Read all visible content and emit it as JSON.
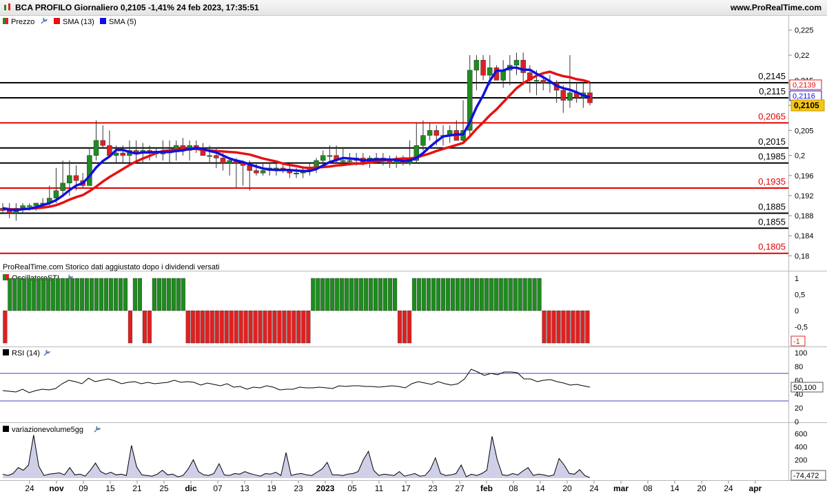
{
  "header": {
    "title": "BCA PROFILO Giornaliero 0,2105 -1,41% 24 feb 2023, 17:35:51",
    "site": "www.ProRealTime.com"
  },
  "legend_main": {
    "prezzo": "Prezzo",
    "sma13": "SMA (13)",
    "sma5": "SMA (5)"
  },
  "notice": "ProRealTime.com  Storico dati aggiustato dopo i dividendi versati",
  "panels": {
    "osc": {
      "name": "OscillatoreSTI",
      "ticks": [
        "1",
        "0,5",
        "0",
        "-0,5",
        "-1"
      ],
      "current": "-1"
    },
    "rsi": {
      "name": "RSI (14)",
      "ticks": [
        "100",
        "80",
        "60",
        "40",
        "20",
        "0"
      ],
      "current": "50,100"
    },
    "vol": {
      "name": "variazionevolume5gg",
      "ticks": [
        "600",
        "400",
        "200",
        "0"
      ],
      "current": "-74,472"
    }
  },
  "price_axis": {
    "ticks": [
      "0,225",
      "0,22",
      "0,215",
      "0,21",
      "0,205",
      "0,2",
      "0,196",
      "0,192",
      "0,188",
      "0,184",
      "0,18"
    ]
  },
  "levels": [
    {
      "label": "0,2145",
      "color": "#000000"
    },
    {
      "label": "0,2115",
      "color": "#000000"
    },
    {
      "label": "0,2065",
      "color": "#e00000"
    },
    {
      "label": "0,2015",
      "color": "#000000"
    },
    {
      "label": "0,1985",
      "color": "#000000"
    },
    {
      "label": "0,1935",
      "color": "#e00000"
    },
    {
      "label": "0,1885",
      "color": "#000000"
    },
    {
      "label": "0,1855",
      "color": "#000000"
    },
    {
      "label": "0,1805",
      "color": "#e00000"
    }
  ],
  "price_tags": {
    "sma13": "0,2139",
    "sma5": "0,2116",
    "last": "0,2105"
  },
  "x_axis": {
    "labels": [
      "24",
      "nov",
      "09",
      "15",
      "21",
      "25",
      "dic",
      "07",
      "13",
      "19",
      "23",
      "2023",
      "05",
      "11",
      "17",
      "23",
      "27",
      "feb",
      "08",
      "14",
      "20",
      "24",
      "mar",
      "08",
      "14",
      "20",
      "24",
      "apr"
    ]
  },
  "colors": {
    "up": "#1e8c1e",
    "down": "#e02020",
    "sma13": "#e81010",
    "sma5": "#1010e0",
    "rsi_band": "#4040c0"
  },
  "chart_data": [
    {
      "type": "candlestick",
      "title": "BCA PROFILO Giornaliero",
      "series_names": [
        "Prezzo",
        "SMA (13)",
        "SMA (5)"
      ],
      "ylim": [
        0.178,
        0.226
      ],
      "x": [
        "24 ott",
        "25 ott",
        "26 ott",
        "27 ott",
        "28 ott",
        "31 ott",
        "1 nov",
        "2 nov",
        "3 nov",
        "4 nov",
        "7 nov",
        "8 nov",
        "9 nov",
        "10 nov",
        "11 nov",
        "14 nov",
        "15 nov",
        "16 nov",
        "17 nov",
        "18 nov",
        "21 nov",
        "22 nov",
        "23 nov",
        "24 nov",
        "25 nov",
        "28 nov",
        "29 nov",
        "30 nov",
        "1 dic",
        "2 dic",
        "5 dic",
        "6 dic",
        "7 dic",
        "8 dic",
        "9 dic",
        "12 dic",
        "13 dic",
        "14 dic",
        "15 dic",
        "16 dic",
        "19 dic",
        "20 dic",
        "21 dic",
        "22 dic",
        "23 dic",
        "27 dic",
        "28 dic",
        "29 dic",
        "30 dic",
        "2 gen",
        "3 gen",
        "4 gen",
        "5 gen",
        "6 gen",
        "9 gen",
        "10 gen",
        "11 gen",
        "12 gen",
        "13 gen",
        "16 gen",
        "17 gen",
        "18 gen",
        "19 gen",
        "20 gen",
        "23 gen",
        "24 gen",
        "25 gen",
        "26 gen",
        "27 gen",
        "30 gen",
        "31 gen",
        "1 feb",
        "2 feb",
        "3 feb",
        "6 feb",
        "7 feb",
        "8 feb",
        "9 feb",
        "10 feb",
        "13 feb",
        "14 feb",
        "15 feb",
        "16 feb",
        "17 feb",
        "20 feb",
        "21 feb",
        "22 feb",
        "23 feb",
        "24 feb"
      ],
      "open": [
        0.1895,
        0.189,
        0.1885,
        0.1895,
        0.19,
        0.19,
        0.1905,
        0.1905,
        0.1915,
        0.193,
        0.1945,
        0.196,
        0.195,
        0.194,
        0.2,
        0.203,
        0.202,
        0.2,
        0.2005,
        0.2,
        0.201,
        0.2005,
        0.201,
        0.2005,
        0.2005,
        0.2005,
        0.201,
        0.202,
        0.201,
        0.202,
        0.2015,
        0.2,
        0.2,
        0.1995,
        0.1985,
        0.199,
        0.1985,
        0.198,
        0.197,
        0.1965,
        0.197,
        0.1975,
        0.1975,
        0.197,
        0.1965,
        0.1965,
        0.197,
        0.1975,
        0.199,
        0.2,
        0.2,
        0.199,
        0.199,
        0.199,
        0.1995,
        0.1985,
        0.1995,
        0.1995,
        0.199,
        0.1985,
        0.199,
        0.1985,
        0.199,
        0.202,
        0.204,
        0.205,
        0.204,
        0.204,
        0.205,
        0.203,
        0.205,
        0.217,
        0.219,
        0.216,
        0.2175,
        0.215,
        0.217,
        0.218,
        0.219,
        0.2165,
        0.215,
        0.215,
        0.2145,
        0.2145,
        0.213,
        0.211,
        0.2125,
        0.2115,
        0.2125
      ],
      "high": [
        0.1905,
        0.1905,
        0.1905,
        0.1905,
        0.1905,
        0.1905,
        0.1915,
        0.194,
        0.1975,
        0.199,
        0.199,
        0.198,
        0.1965,
        0.2015,
        0.207,
        0.206,
        0.205,
        0.202,
        0.202,
        0.203,
        0.203,
        0.2025,
        0.202,
        0.2015,
        0.203,
        0.203,
        0.203,
        0.2035,
        0.203,
        0.203,
        0.2025,
        0.202,
        0.2015,
        0.2005,
        0.1995,
        0.1995,
        0.199,
        0.199,
        0.1985,
        0.1985,
        0.1985,
        0.199,
        0.1985,
        0.198,
        0.1975,
        0.1975,
        0.1985,
        0.1995,
        0.201,
        0.202,
        0.202,
        0.2015,
        0.2005,
        0.2005,
        0.2005,
        0.2,
        0.2005,
        0.2005,
        0.2,
        0.2,
        0.2,
        0.203,
        0.2065,
        0.207,
        0.2065,
        0.206,
        0.206,
        0.206,
        0.207,
        0.211,
        0.22,
        0.22,
        0.22,
        0.22,
        0.218,
        0.219,
        0.22,
        0.2205,
        0.2205,
        0.218,
        0.217,
        0.216,
        0.216,
        0.215,
        0.214,
        0.22,
        0.2145,
        0.2145,
        0.2145
      ],
      "low": [
        0.1885,
        0.1875,
        0.187,
        0.1885,
        0.189,
        0.189,
        0.1895,
        0.19,
        0.1905,
        0.192,
        0.192,
        0.193,
        0.1935,
        0.194,
        0.199,
        0.2015,
        0.2,
        0.1985,
        0.1985,
        0.1985,
        0.199,
        0.1985,
        0.199,
        0.1995,
        0.199,
        0.1985,
        0.199,
        0.2,
        0.199,
        0.2005,
        0.2,
        0.1985,
        0.1975,
        0.197,
        0.196,
        0.1935,
        0.194,
        0.193,
        0.196,
        0.196,
        0.196,
        0.196,
        0.1965,
        0.1955,
        0.1955,
        0.1955,
        0.196,
        0.1965,
        0.1975,
        0.1985,
        0.1985,
        0.198,
        0.198,
        0.198,
        0.198,
        0.1975,
        0.1985,
        0.198,
        0.1975,
        0.1975,
        0.198,
        0.198,
        0.1985,
        0.201,
        0.203,
        0.202,
        0.202,
        0.2025,
        0.203,
        0.2025,
        0.204,
        0.213,
        0.215,
        0.214,
        0.215,
        0.2135,
        0.214,
        0.216,
        0.214,
        0.2125,
        0.212,
        0.213,
        0.2125,
        0.2105,
        0.2085,
        0.2095,
        0.2105,
        0.2095,
        0.21
      ],
      "close": [
        0.189,
        0.1885,
        0.1895,
        0.19,
        0.19,
        0.1905,
        0.1905,
        0.1915,
        0.193,
        0.1945,
        0.196,
        0.195,
        0.194,
        0.2,
        0.203,
        0.202,
        0.2,
        0.2005,
        0.2,
        0.201,
        0.2005,
        0.201,
        0.2005,
        0.2005,
        0.2005,
        0.201,
        0.202,
        0.201,
        0.202,
        0.2015,
        0.2,
        0.2,
        0.1995,
        0.1985,
        0.199,
        0.1985,
        0.198,
        0.197,
        0.1965,
        0.197,
        0.1975,
        0.1975,
        0.197,
        0.1965,
        0.1965,
        0.197,
        0.1975,
        0.199,
        0.2,
        0.2,
        0.199,
        0.199,
        0.199,
        0.1995,
        0.1985,
        0.1995,
        0.1995,
        0.199,
        0.1985,
        0.199,
        0.1985,
        0.199,
        0.202,
        0.204,
        0.205,
        0.204,
        0.204,
        0.205,
        0.203,
        0.205,
        0.217,
        0.219,
        0.216,
        0.2175,
        0.215,
        0.217,
        0.218,
        0.219,
        0.2165,
        0.215,
        0.215,
        0.2145,
        0.2145,
        0.213,
        0.211,
        0.2125,
        0.2115,
        0.2125,
        0.2105
      ],
      "sma13": [
        0.1895,
        0.1893,
        0.1892,
        0.1893,
        0.1894,
        0.1895,
        0.1896,
        0.1898,
        0.1901,
        0.1906,
        0.1912,
        0.1917,
        0.1921,
        0.1929,
        0.1938,
        0.1948,
        0.1957,
        0.1965,
        0.1973,
        0.1981,
        0.1988,
        0.1994,
        0.1999,
        0.2005,
        0.2009,
        0.201,
        0.2012,
        0.2012,
        0.2013,
        0.2013,
        0.2011,
        0.201,
        0.2009,
        0.2008,
        0.2007,
        0.2006,
        0.2004,
        0.2002,
        0.1998,
        0.1994,
        0.1991,
        0.1988,
        0.1984,
        0.1981,
        0.1979,
        0.1976,
        0.1975,
        0.1976,
        0.1977,
        0.1978,
        0.198,
        0.1981,
        0.1983,
        0.1984,
        0.1984,
        0.1986,
        0.1988,
        0.199,
        0.1991,
        0.1993,
        0.1994,
        0.1994,
        0.1996,
        0.2,
        0.2004,
        0.2009,
        0.2013,
        0.2017,
        0.2021,
        0.2025,
        0.2038,
        0.2053,
        0.2066,
        0.208,
        0.2092,
        0.2106,
        0.212,
        0.2134,
        0.2144,
        0.2152,
        0.2159,
        0.2164,
        0.2167,
        0.2162,
        0.2158,
        0.2156,
        0.2152,
        0.215,
        0.2146
      ],
      "sma5": [
        0.1895,
        0.1892,
        0.1891,
        0.1893,
        0.1894,
        0.1897,
        0.1901,
        0.1905,
        0.1911,
        0.192,
        0.1931,
        0.194,
        0.1945,
        0.1959,
        0.1976,
        0.1989,
        0.1998,
        0.2011,
        0.2011,
        0.2007,
        0.2004,
        0.2006,
        0.2006,
        0.2007,
        0.2007,
        0.2007,
        0.2009,
        0.201,
        0.2013,
        0.2015,
        0.2013,
        0.2009,
        0.2006,
        0.2,
        0.1994,
        0.199,
        0.1987,
        0.1982,
        0.1978,
        0.1974,
        0.1972,
        0.1971,
        0.1971,
        0.1971,
        0.197,
        0.1969,
        0.1969,
        0.1973,
        0.198,
        0.1987,
        0.1991,
        0.1995,
        0.1994,
        0.1993,
        0.199,
        0.1991,
        0.1992,
        0.1992,
        0.1992,
        0.1991,
        0.1989,
        0.199,
        0.1995,
        0.2005,
        0.2017,
        0.2028,
        0.2038,
        0.204,
        0.2042,
        0.2042,
        0.2066,
        0.2096,
        0.212,
        0.2149,
        0.2169,
        0.2169,
        0.2175,
        0.2175,
        0.2171,
        0.2171,
        0.2163,
        0.2156,
        0.2148,
        0.2139,
        0.2134,
        0.2131,
        0.2126,
        0.212,
        0.2116
      ],
      "levels": [
        0.2145,
        0.2115,
        0.2065,
        0.2015,
        0.1985,
        0.1935,
        0.1885,
        0.1855,
        0.1805
      ]
    },
    {
      "type": "bar",
      "title": "OscillatoreSTI",
      "ylim": [
        -1,
        1
      ],
      "values": [
        -1,
        1,
        1,
        1,
        1,
        1,
        1,
        1,
        1,
        1,
        1,
        1,
        1,
        1,
        1,
        1,
        1,
        1,
        1,
        1,
        1,
        1,
        1,
        1,
        1,
        1,
        -1,
        1,
        1,
        -1,
        -1,
        1,
        1,
        1,
        1,
        1,
        1,
        1,
        -1,
        -1,
        -1,
        -1,
        -1,
        -1,
        -1,
        -1,
        -1,
        -1,
        -1,
        -1,
        -1,
        -1,
        -1,
        -1,
        -1,
        -1,
        -1,
        -1,
        -1,
        -1,
        -1,
        -1,
        -1,
        -1,
        1,
        1,
        1,
        1,
        1,
        1,
        1,
        1,
        1,
        1,
        1,
        1,
        1,
        1,
        1,
        1,
        1,
        1,
        -1,
        -1,
        -1,
        1,
        1,
        1,
        1,
        1,
        1,
        1,
        1,
        1,
        1,
        1,
        1,
        1,
        1,
        1,
        1,
        1,
        1,
        1,
        1,
        1,
        1,
        1,
        1,
        1,
        1,
        1,
        -1,
        -1,
        -1,
        -1,
        -1,
        -1,
        -1,
        -1,
        -1,
        -1
      ]
    },
    {
      "type": "line",
      "title": "RSI (14)",
      "ylim": [
        0,
        100
      ],
      "bands": [
        70,
        30
      ],
      "values": [
        45,
        44,
        43,
        47,
        42,
        45,
        47,
        46,
        48,
        55,
        60,
        58,
        55,
        63,
        58,
        60,
        62,
        59,
        55,
        57,
        58,
        55,
        57,
        55,
        56,
        57,
        60,
        57,
        58,
        57,
        53,
        56,
        54,
        52,
        55,
        50,
        51,
        47,
        50,
        49,
        52,
        50,
        46,
        47,
        47,
        50,
        49,
        49,
        50,
        49,
        48,
        52,
        51,
        52,
        52,
        51,
        51,
        50,
        51,
        52,
        51,
        49,
        55,
        58,
        56,
        54,
        58,
        55,
        53,
        55,
        62,
        76,
        72,
        67,
        70,
        68,
        72,
        72,
        71,
        62,
        62,
        58,
        60,
        61,
        58,
        56,
        53,
        54,
        52,
        50
      ]
    },
    {
      "type": "area",
      "title": "variazionevolume5gg",
      "ylim": [
        -80,
        700
      ],
      "values": [
        -20,
        -40,
        -10,
        80,
        40,
        120,
        580,
        100,
        -40,
        -20,
        -10,
        0,
        -30,
        80,
        -30,
        -20,
        -50,
        40,
        150,
        20,
        -20,
        10,
        -30,
        -20,
        -40,
        420,
        90,
        -30,
        -40,
        -50,
        -20,
        40,
        -30,
        -20,
        -60,
        -40,
        60,
        200,
        20,
        -30,
        -40,
        -10,
        140,
        -30,
        -40,
        -10,
        -20,
        20,
        -10,
        -30,
        -50,
        -10,
        -20,
        10,
        -40,
        310,
        -40,
        -20,
        -10,
        -30,
        -40,
        10,
        60,
        160,
        -30,
        -30,
        -40,
        -20,
        -10,
        20,
        200,
        330,
        40,
        -40,
        -20,
        -30,
        -40,
        20,
        -50,
        -30,
        -10,
        -50,
        -40,
        50,
        230,
        -10,
        -40,
        -30,
        -10,
        120,
        -60,
        -20,
        -40,
        -10,
        40,
        560,
        200,
        -30,
        -40,
        -10,
        -30,
        30,
        80,
        -40,
        -20,
        -30,
        -50,
        -30,
        220,
        120,
        -10,
        -20,
        50,
        -40,
        -74
      ]
    }
  ]
}
